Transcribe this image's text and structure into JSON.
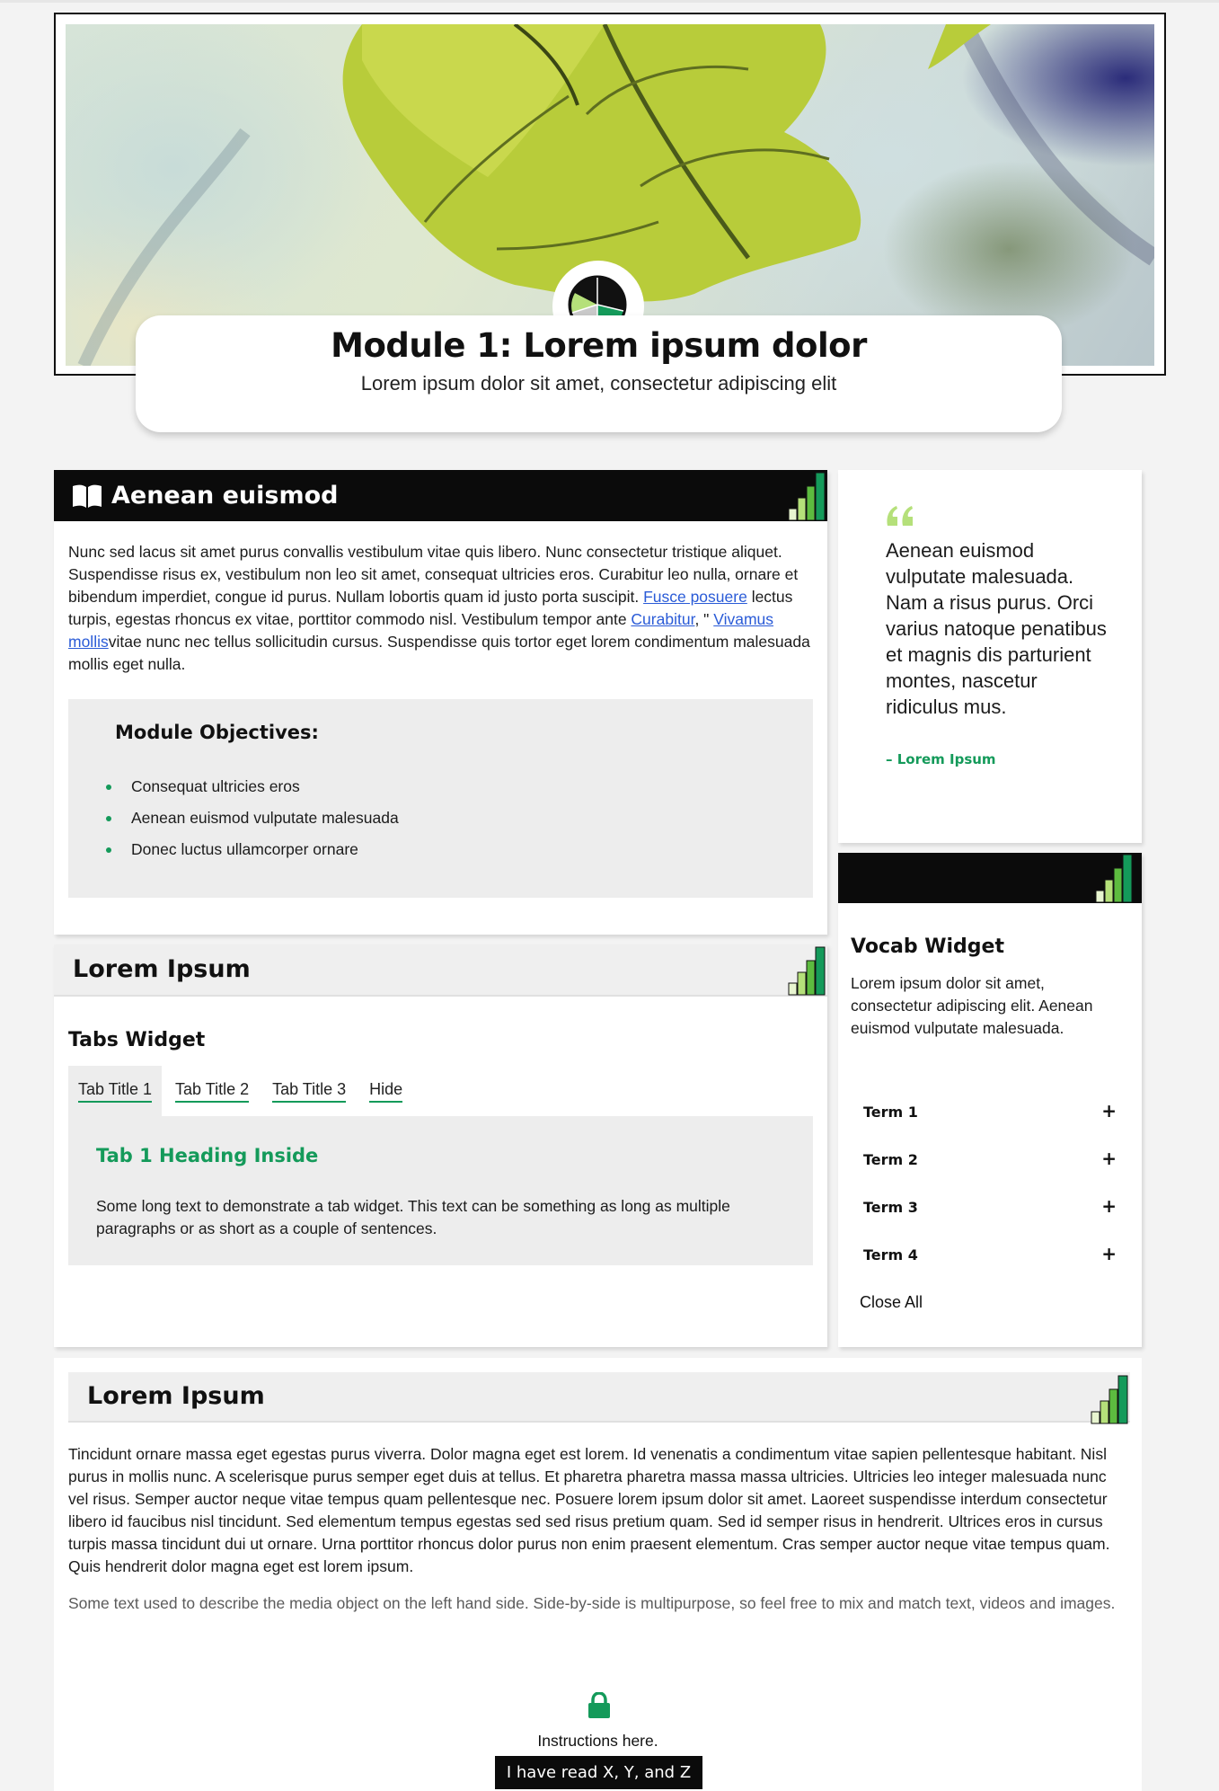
{
  "hero": {
    "title": "Module 1: Lorem ipsum dolor",
    "subtitle": "Lorem ipsum dolor sit amet, consectetur adipiscing elit"
  },
  "section1": {
    "heading": "Aenean euismod",
    "paragraph": {
      "part1": "Nunc sed lacus sit amet purus convallis vestibulum vitae quis libero. Nunc consectetur tristique aliquet. Suspendisse risus ex, vestibulum non leo sit amet, consequat ultricies eros. Curabitur leo nulla, ornare et bibendum imperdiet, congue id purus. Nullam lobortis quam id justo porta suscipit. ",
      "link1": "Fusce posuere",
      "part2": " lectus turpis, egestas rhoncus ex vitae, porttitor commodo nisl. Vestibulum tempor ante ",
      "link2": "Curabitur",
      "part3": ", \" ",
      "link3": "Vivamus mollis",
      "part4": "vitae nunc nec tellus sollicitudin cursus. Suspendisse quis tortor eget lorem condimentum malesuada mollis eget nulla."
    },
    "objectives": {
      "heading": "Module Objectives:",
      "items": [
        "Consequat ultricies eros",
        "Aenean euismod vulputate malesuada",
        "Donec luctus ullamcorper ornare"
      ]
    }
  },
  "quote": {
    "text": "Aenean euismod vulputate malesuada. Nam a risus purus. Orci varius natoque penatibus et magnis dis parturient montes, nascetur ridiculus mus.",
    "author": "– Lorem Ipsum"
  },
  "section2": {
    "heading": "Lorem Ipsum",
    "widget_title": "Tabs Widget",
    "tabs": [
      "Tab Title 1",
      "Tab Title 2",
      "Tab Title 3",
      "Hide"
    ],
    "active_tab": "Tab Title 1",
    "panel": {
      "heading": "Tab 1 Heading Inside",
      "text": "Some long text to demonstrate a tab widget. This text can be something as long as multiple paragraphs or as short as a couple of sentences."
    }
  },
  "vocab": {
    "title": "Vocab Widget",
    "description": "Lorem ipsum dolor sit amet, consectetur adipiscing elit. Aenean euismod vulputate malesuada.",
    "terms": [
      "Term 1",
      "Term 2",
      "Term 3",
      "Term 4"
    ],
    "expand_symbol": "+",
    "close_all": "Close All"
  },
  "section3": {
    "heading": "Lorem Ipsum",
    "paragraph": "Tincidunt ornare massa eget egestas purus viverra. Dolor magna eget est lorem. Id venenatis a condimentum vitae sapien pellentesque habitant. Nisl purus in mollis nunc. A scelerisque purus semper eget duis at tellus. Et pharetra pharetra massa massa ultricies. Ultricies leo integer malesuada nunc vel risus. Semper auctor neque vitae tempus quam pellentesque nec. Posuere lorem ipsum dolor sit amet. Laoreet suspendisse interdum consectetur libero id faucibus nisl tincidunt. Sed elementum tempus egestas sed sed risus pretium quam. Sed id semper risus in hendrerit. Ultrices eros in cursus turpis massa tincidunt dui ut ornare. Urna porttitor rhoncus dolor purus non enim praesent elementum. Cras semper auctor neque vitae tempus quam. Quis hendrerit dolor magna eget est lorem ipsum.",
    "media_text": "Some text used to describe the media object on the left hand side. Side-by-side is multipurpose, so feel free to mix and match text, videos and images.",
    "instructions": "Instructions here.",
    "button": "I have read X, Y, and Z"
  },
  "icons": {
    "hero_badge": "pie-badge-icon",
    "book": "book-open-icon",
    "level_bars": "signal-bars-icon",
    "quote": "quote-icon",
    "lock": "lock-icon"
  },
  "colors": {
    "accent_green": "#149a5a",
    "light_green": "#b5e07a",
    "header_black": "#0b0b0b",
    "panel_grey": "#ededed",
    "link_blue": "#2a5bd7"
  }
}
